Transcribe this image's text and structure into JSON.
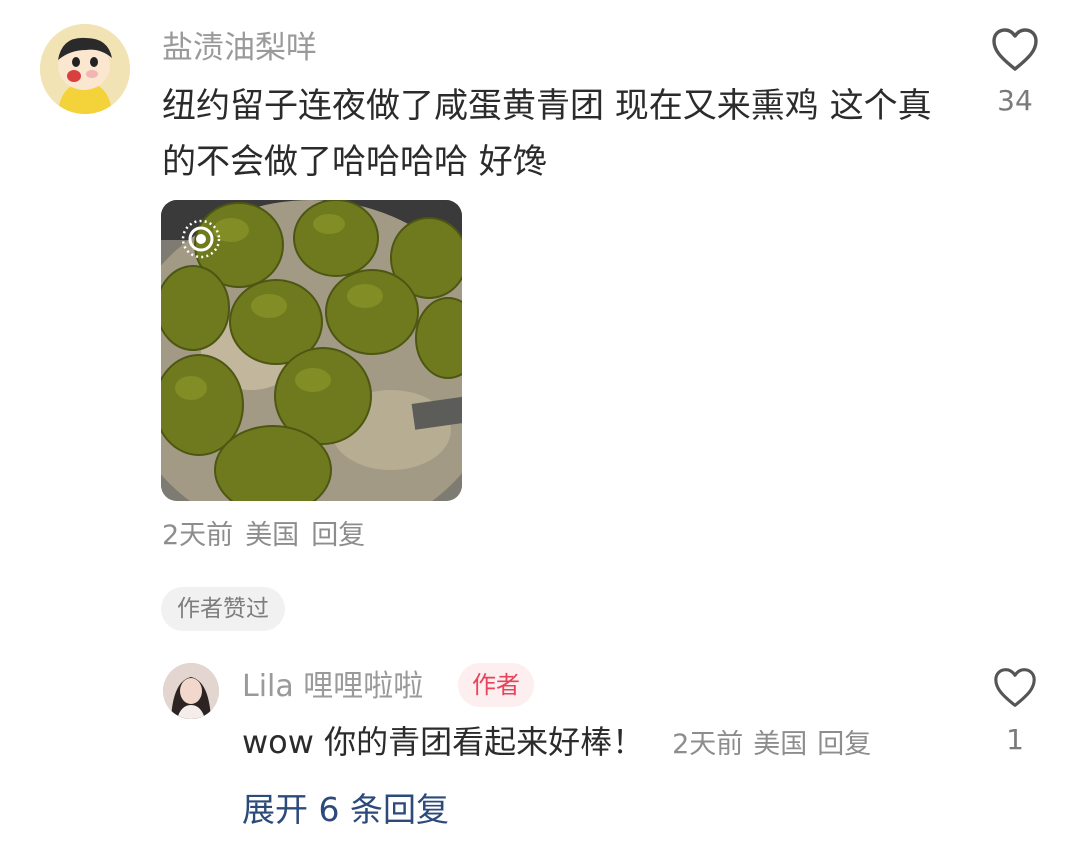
{
  "comment": {
    "username": "盐渍油梨咩",
    "text": "纽约留子连夜做了咸蛋黄青团 现在又来熏鸡 这个真的不会做了哈哈哈哈 好馋",
    "time": "2天前",
    "location": "美国",
    "reply_label": "回复",
    "author_liked": "作者赞过",
    "like_count": "34",
    "avatar_icon": "cartoon-avatar",
    "image_icon": "live-photo-icon"
  },
  "reply": {
    "username": "Lila 哩哩啦啦",
    "author_badge": "作者",
    "text": "wow 你的青团看起来好棒！",
    "time": "2天前",
    "location": "美国",
    "reply_label": "回复",
    "like_count": "1"
  },
  "expand_label": "展开 6 条回复",
  "colors": {
    "username": "#9a9a9a",
    "text": "#2b2b2b",
    "meta": "#8d8d8d",
    "author_badge_text": "#e8435a",
    "author_badge_bg": "#fdeef0",
    "expand_link": "#2c4a7a"
  }
}
